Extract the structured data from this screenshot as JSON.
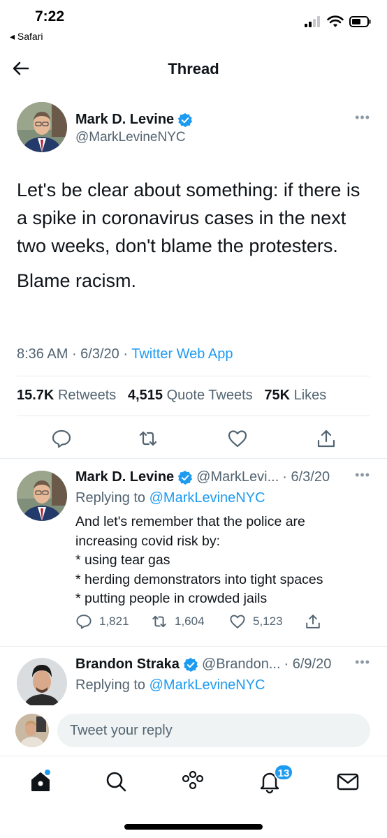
{
  "status_bar": {
    "time": "7:22",
    "back_app": "◂ Safari"
  },
  "nav": {
    "title": "Thread"
  },
  "main_tweet": {
    "name": "Mark D. Levine",
    "handle": "@MarkLevineNYC",
    "text_1": "Let's be clear about something: if there is a spike in coronavirus cases in the next two weeks, don't blame the protesters.",
    "text_2": "Blame racism.",
    "time": "8:36 AM",
    "date": "6/3/20",
    "source": "Twitter Web App",
    "retweets_count": "15.7K",
    "retweets_label": "Retweets",
    "quotes_count": "4,515",
    "quotes_label": "Quote Tweets",
    "likes_count": "75K",
    "likes_label": "Likes"
  },
  "replies": [
    {
      "name": "Mark D. Levine",
      "handle": "@MarkLevi...",
      "date": "· 6/3/20",
      "replying_prefix": "Replying to",
      "replying_to": "@MarkLevineNYC",
      "lines": [
        "And let's remember that the police are",
        "increasing covid risk by:",
        "* using tear gas",
        "* herding demonstrators into tight spaces",
        "* putting people in crowded jails"
      ],
      "reply_count": "1,821",
      "retweet_count": "1,604",
      "like_count": "5,123"
    },
    {
      "name": "Brandon Straka",
      "handle": "@Brandon...",
      "date": "· 6/9/20",
      "replying_prefix": "Replying to",
      "replying_to": "@MarkLevineNYC"
    }
  ],
  "composer": {
    "placeholder": "Tweet your reply"
  },
  "tabbar": {
    "notifications_badge": "13"
  },
  "colors": {
    "accent": "#1d9bf0",
    "secondary_text": "#536471",
    "primary_text": "#0f1419"
  },
  "icons": [
    "back-arrow-icon",
    "verified-badge-icon",
    "more-icon",
    "reply-icon",
    "retweet-icon",
    "like-icon",
    "share-icon",
    "home-icon",
    "search-icon",
    "spaces-icon",
    "bell-icon",
    "mail-icon",
    "signal-icon",
    "wifi-icon",
    "battery-icon"
  ]
}
